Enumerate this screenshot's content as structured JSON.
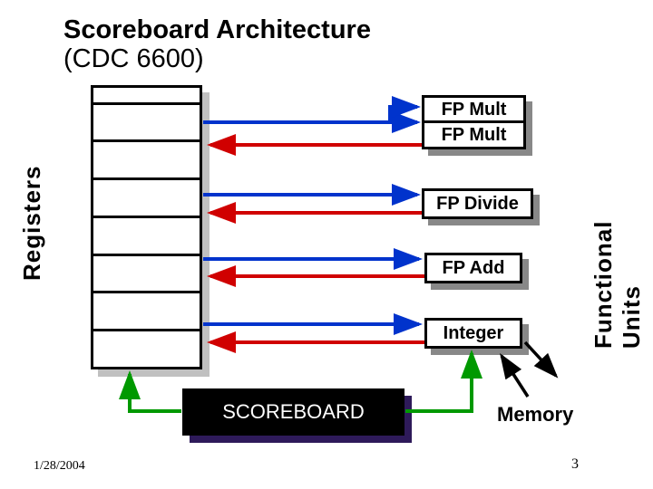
{
  "title_line1": "Scoreboard Architecture",
  "title_line2": "(CDC 6600)",
  "registers_label": "Registers",
  "functional_units_label": "Functional Units",
  "units": {
    "fp_mult1": "FP Mult",
    "fp_mult2": "FP Mult",
    "fp_divide": "FP Divide",
    "fp_add": "FP Add",
    "integer": "Integer"
  },
  "scoreboard": "SCOREBOARD",
  "memory_label": "Memory",
  "date": "1/28/2004",
  "page": "3",
  "colors": {
    "red": "#d00000",
    "blue": "#0033cc",
    "green": "#009900",
    "black": "#000000"
  }
}
